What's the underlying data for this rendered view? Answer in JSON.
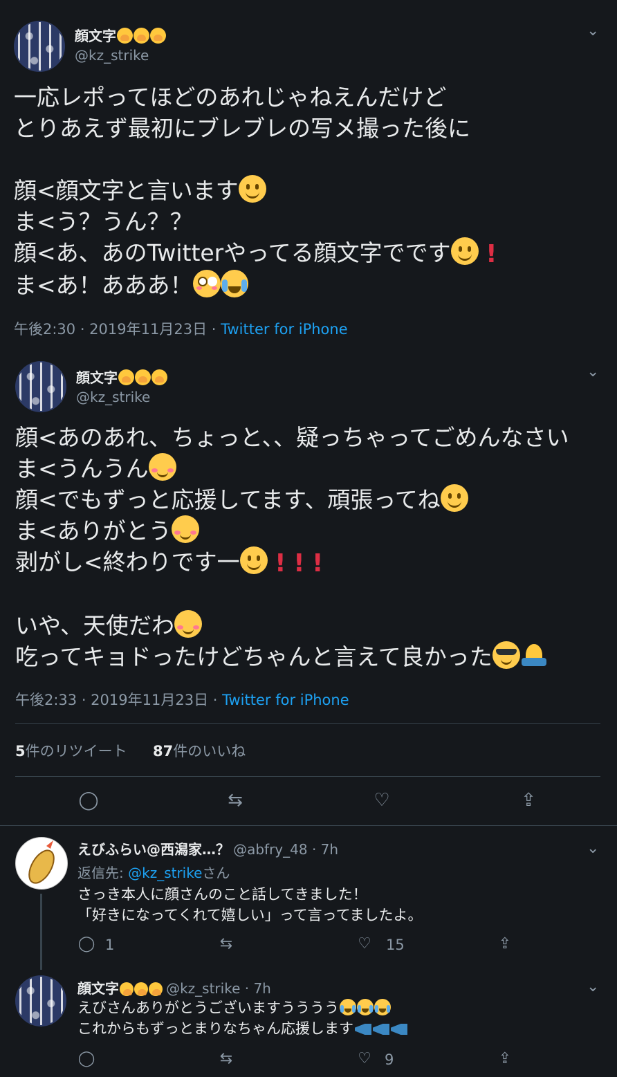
{
  "tweet1": {
    "name": "顔文字",
    "handle": "@kz_strike",
    "lines": [
      "一応レポってほどのあれじゃねえんだけど",
      "とりあえず最初にブレブレの写メ撮った後に",
      "",
      "顔<顔文字と言います",
      "ま<う？うん？？",
      "顔<あ、あのTwitterやってる顔文字でです",
      "ま<あ！あああ！"
    ],
    "time": "午後2:30 · 2019年11月23日",
    "dot": "·",
    "via": "Twitter for iPhone"
  },
  "tweet2": {
    "name": "顔文字",
    "handle": "@kz_strike",
    "lines": [
      "顔<あのあれ、ちょっと、、疑っちゃってごめんなさい",
      "ま<うんうん",
      "顔<でもずっと応援してます、頑張ってね",
      "ま<ありがとう",
      "剥がし<終わりです一",
      "",
      "いや、天使だわ",
      "吃ってキョドったけどちゃんと言えて良かった"
    ],
    "time": "午後2:33 · 2019年11月23日",
    "dot": "·",
    "via": "Twitter for iPhone"
  },
  "stats": {
    "retweets_num": "5",
    "retweets_label": "件のリツイート",
    "likes_num": "87",
    "likes_label": "件のいいね"
  },
  "reply1": {
    "name": "えびふらい@西潟家…？",
    "handle": "@abfry_48 · 7h",
    "replying_prefix": "返信先: ",
    "replying_mention": "@kz_strike",
    "replying_suffix": "さん",
    "lines": [
      "さっき本人に顔さんのこと話してきました！",
      "「好きになってくれて嬉しい」って言ってましたよ。"
    ],
    "reply_count": "1",
    "like_count": "15"
  },
  "reply2": {
    "name": "顔文字",
    "handle": "@kz_strike · 7h",
    "lines": [
      "えびさんありがとうございますうううう",
      "これからもずっとまりなちゃん応援します"
    ],
    "like_count": "9"
  },
  "icons": {
    "chevron": "⌄",
    "reply": "◯",
    "retweet": "⇆",
    "like": "♡",
    "share": "⇪"
  },
  "colors": {
    "background": "#15181c",
    "link": "#1da1f2",
    "secondary": "#8b98a5"
  }
}
